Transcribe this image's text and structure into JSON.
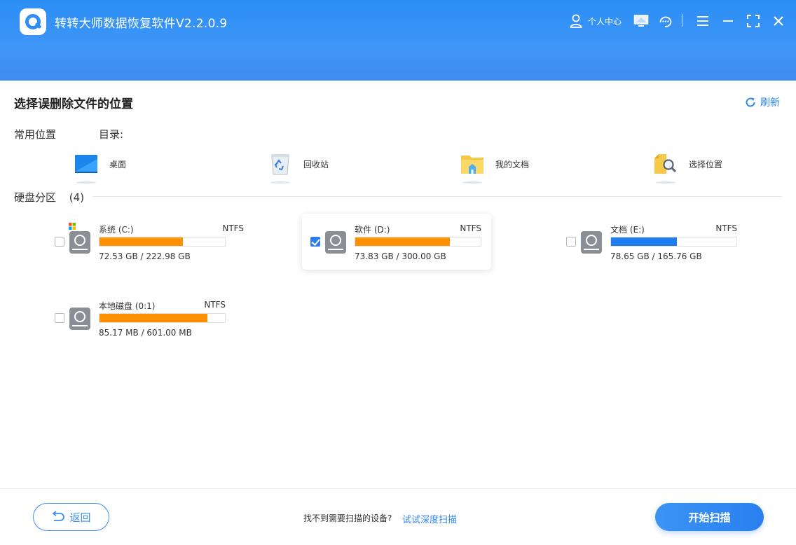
{
  "app": {
    "title": "转转大师数据恢复软件V2.2.0.9"
  },
  "header": {
    "user_label": "个人中心"
  },
  "main": {
    "section_title": "选择误删除文件的位置",
    "refresh_label": "刷新",
    "common_label": "常用位置",
    "dir_label": "目录:",
    "locations": [
      {
        "label": "桌面",
        "icon": "desktop-icon"
      },
      {
        "label": "回收站",
        "icon": "recycle-bin-icon"
      },
      {
        "label": "我的文档",
        "icon": "documents-folder-icon"
      },
      {
        "label": "选择位置",
        "icon": "folder-search-icon"
      }
    ],
    "disk_head": "硬盘分区",
    "disk_count": "(4)",
    "disks": [
      {
        "name": "系统  (C:)",
        "fs": "NTFS",
        "size": "72.53 GB / 222.98 GB",
        "used_fraction": 0.6627,
        "color": "#ff9000",
        "checked": false
      },
      {
        "name": "软件  (D:)",
        "fs": "NTFS",
        "size": "73.83 GB / 300.00 GB",
        "used_fraction": 0.7539,
        "color": "#ff9000",
        "checked": true
      },
      {
        "name": "文档  (E:)",
        "fs": "NTFS",
        "size": "78.65 GB / 165.76 GB",
        "used_fraction": 0.5255,
        "color": "#1e7ef0",
        "checked": false
      },
      {
        "name": "本地磁盘  (0:1)",
        "fs": "NTFS",
        "size": "85.17 MB / 601.00 MB",
        "used_fraction": 0.8583,
        "color": "#ff9000",
        "checked": false
      }
    ]
  },
  "footer": {
    "back_label": "返回",
    "hint": "找不到需要扫描的设备?",
    "deep_scan_label": "试试深度扫描",
    "start_label": "开始扫描"
  }
}
